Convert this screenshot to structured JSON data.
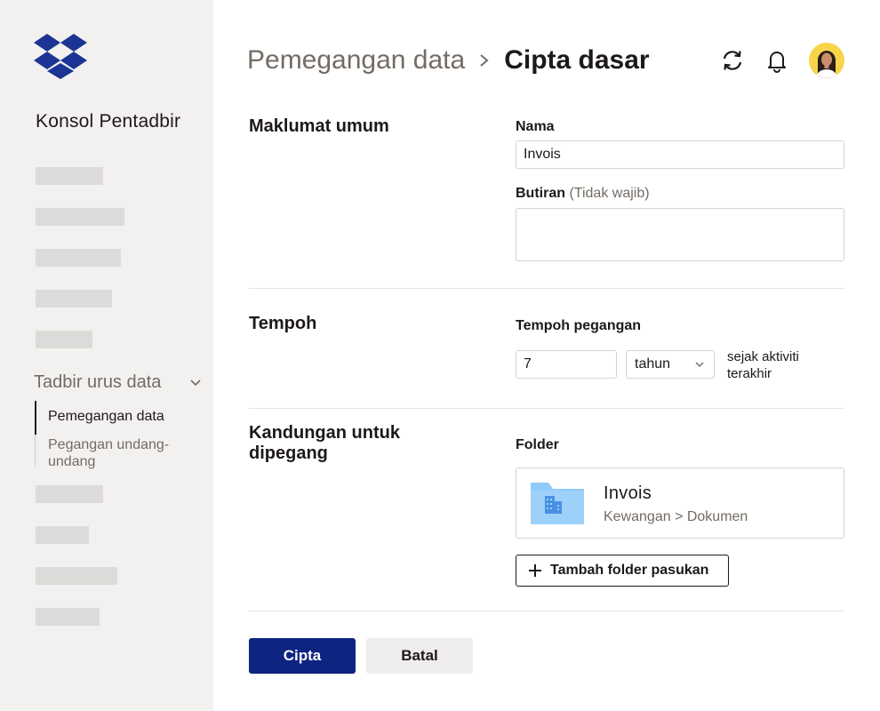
{
  "sidebar": {
    "console_title": "Konsol Pentadbir",
    "nav_group": "Tadbir urus data",
    "sub_items": [
      {
        "label": "Pemegangan data",
        "active": true
      },
      {
        "label": "Pegangan undang-undang",
        "active": false
      }
    ]
  },
  "header": {
    "breadcrumb_parent": "Pemegangan data",
    "breadcrumb_current": "Cipta dasar",
    "icons": [
      "sync-icon",
      "bell-icon",
      "avatar"
    ]
  },
  "general": {
    "section_title": "Maklumat umum",
    "name_label": "Nama",
    "name_value": "Invois",
    "details_label": "Butiran",
    "details_optional": "(Tidak wajib)",
    "details_value": ""
  },
  "duration": {
    "section_title": "Tempoh",
    "retention_label": "Tempoh pegangan",
    "retention_value": "7",
    "unit_selected": "tahun",
    "since_text": "sejak aktiviti terakhir"
  },
  "content": {
    "section_title": "Kandungan untuk dipegang",
    "folder_label": "Folder",
    "folder_name": "Invois",
    "folder_path": "Kewangan > Dokumen",
    "add_folder_label": "Tambah folder pasukan"
  },
  "actions": {
    "create_label": "Cipta",
    "cancel_label": "Batal"
  },
  "colors": {
    "brand_blue": "#0d2481",
    "logo_blue": "#1c3494",
    "folder_blue": "#90caf9",
    "sidebar_bg": "#f2f1f0",
    "avatar_bg": "#f7d44a"
  }
}
